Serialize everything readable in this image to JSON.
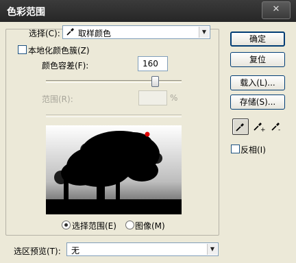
{
  "window": {
    "title": "色彩范围",
    "close_glyph": "✕"
  },
  "select": {
    "label": "选择(C):",
    "value": "取样颜色",
    "icon": "eyedropper-icon"
  },
  "localized_clusters": {
    "label": "本地化颜色簇(Z)",
    "checked": false
  },
  "fuzziness": {
    "label": "颜色容差(F):",
    "value": "160",
    "slider_fraction": 0.8
  },
  "range": {
    "label": "范围(R):",
    "value": "",
    "unit": "%",
    "disabled": true
  },
  "view_mode": {
    "options": [
      {
        "label": "选择范围(E)",
        "selected": true
      },
      {
        "label": "图像(M)",
        "selected": false
      }
    ]
  },
  "selection_preview": {
    "label": "选区预览(T):",
    "value": "无"
  },
  "buttons": {
    "ok": "确定",
    "reset": "复位",
    "load": "载入(L)...",
    "save": "存储(S)..."
  },
  "tools": [
    {
      "name": "eyedropper-icon",
      "glyph": "",
      "active": true
    },
    {
      "name": "eyedropper-plus-icon",
      "glyph": "+",
      "active": false
    },
    {
      "name": "eyedropper-minus-icon",
      "glyph": "-",
      "active": false
    }
  ],
  "invert": {
    "label": "反相(I)",
    "checked": false
  },
  "colors": {
    "title_bar": "#2f2f2f",
    "dialog_bg": "#ece9d8",
    "sample_marker": "#e00000"
  }
}
